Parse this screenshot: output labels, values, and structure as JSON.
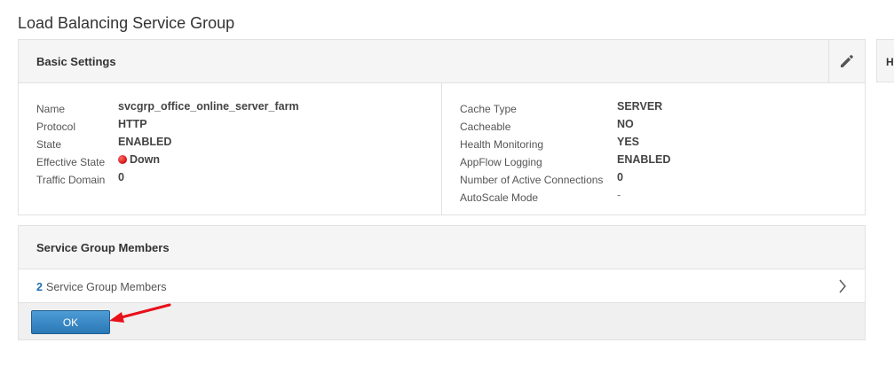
{
  "page": {
    "title": "Load Balancing Service Group"
  },
  "basic_settings": {
    "title": "Basic Settings",
    "left": [
      {
        "label": "Name",
        "value": "svcgrp_office_online_server_farm"
      },
      {
        "label": "Protocol",
        "value": "HTTP"
      },
      {
        "label": "State",
        "value": "ENABLED"
      },
      {
        "label": "Effective State",
        "value": "Down",
        "status_color": "#d01010"
      },
      {
        "label": "Traffic Domain",
        "value": "0"
      }
    ],
    "right": [
      {
        "label": "Cache Type",
        "value": "SERVER"
      },
      {
        "label": "Cacheable",
        "value": "NO"
      },
      {
        "label": "Health Monitoring",
        "value": "YES"
      },
      {
        "label": "AppFlow Logging",
        "value": "ENABLED"
      },
      {
        "label": "Number of Active Connections",
        "value": "0"
      },
      {
        "label": "AutoScale Mode",
        "value": "-"
      }
    ]
  },
  "service_group_members": {
    "title": "Service Group Members",
    "count": "2",
    "label": "Service Group Members"
  },
  "actions": {
    "ok_label": "OK"
  },
  "side_panel": {
    "label": "H"
  },
  "colors": {
    "accent": "#2a78b5",
    "link": "#1f6fb2",
    "status_down": "#d01010",
    "annotation": "#e8101a"
  },
  "icons": {
    "edit": "pencil-icon",
    "expand": "chevron-right-icon",
    "status": "status-dot-icon",
    "annotation": "red-arrow-icon"
  }
}
